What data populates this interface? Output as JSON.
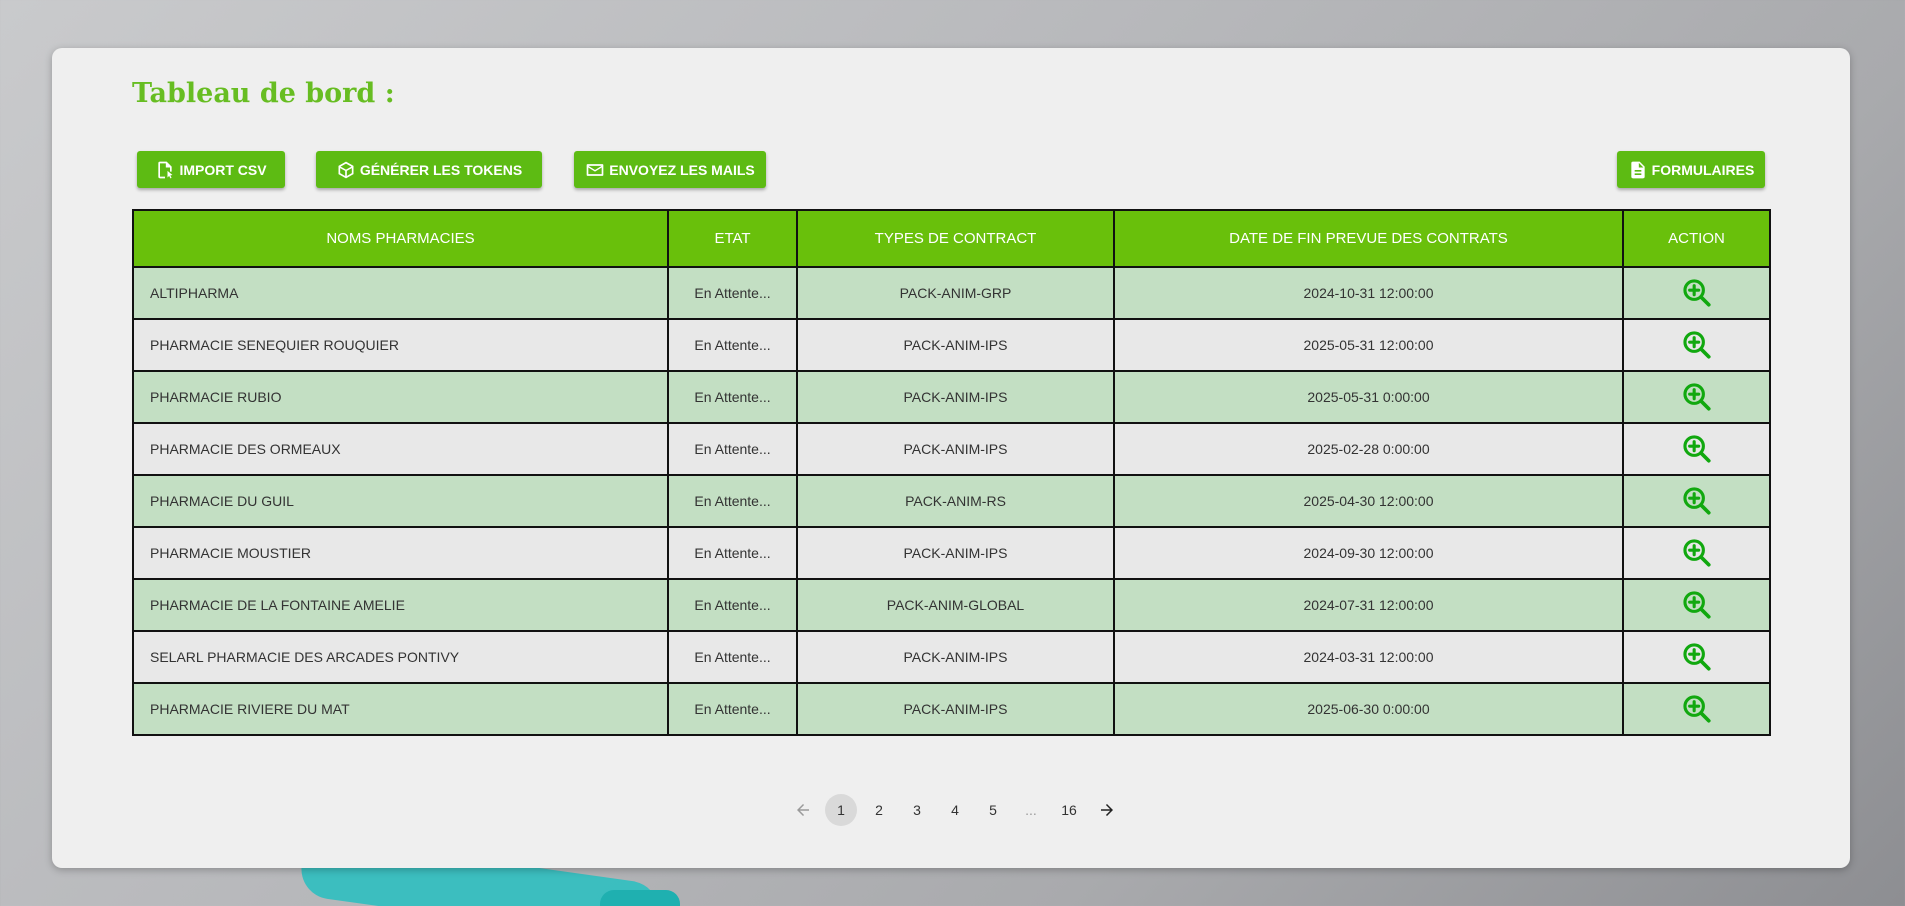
{
  "page": {
    "title": "Tableau de bord :"
  },
  "toolbar": {
    "import_label": "IMPORT CSV",
    "tokens_label": "GÉNÉRER LES TOKENS",
    "mails_label": "ENVOYEZ LES MAILS",
    "forms_label": "FORMULAIRES"
  },
  "table": {
    "headers": [
      "NOMS PHARMACIES",
      "ETAT",
      "TYPES DE CONTRACT",
      "DATE DE FIN PREVUE DES CONTRATS",
      "ACTION"
    ],
    "rows": [
      {
        "name": "ALTIPHARMA",
        "etat": "En Attente...",
        "type": "PACK-ANIM-GRP",
        "date": "2024-10-31 12:00:00"
      },
      {
        "name": "PHARMACIE SENEQUIER ROUQUIER",
        "etat": "En Attente...",
        "type": "PACK-ANIM-IPS",
        "date": "2025-05-31 12:00:00"
      },
      {
        "name": "PHARMACIE RUBIO",
        "etat": "En Attente...",
        "type": "PACK-ANIM-IPS",
        "date": "2025-05-31 0:00:00"
      },
      {
        "name": "PHARMACIE DES ORMEAUX",
        "etat": "En Attente...",
        "type": "PACK-ANIM-IPS",
        "date": "2025-02-28 0:00:00"
      },
      {
        "name": "PHARMACIE DU GUIL",
        "etat": "En Attente...",
        "type": "PACK-ANIM-RS",
        "date": "2025-04-30 12:00:00"
      },
      {
        "name": "PHARMACIE MOUSTIER",
        "etat": "En Attente...",
        "type": "PACK-ANIM-IPS",
        "date": "2024-09-30 12:00:00"
      },
      {
        "name": "PHARMACIE DE LA FONTAINE AMELIE",
        "etat": "En Attente...",
        "type": "PACK-ANIM-GLOBAL",
        "date": "2024-07-31 12:00:00"
      },
      {
        "name": "SELARL PHARMACIE DES ARCADES PONTIVY",
        "etat": "En Attente...",
        "type": "PACK-ANIM-IPS",
        "date": "2024-03-31 12:00:00"
      },
      {
        "name": "PHARMACIE RIVIERE DU MAT",
        "etat": "En Attente...",
        "type": "PACK-ANIM-IPS",
        "date": "2025-06-30 0:00:00"
      }
    ]
  },
  "pagination": {
    "pages": [
      "1",
      "2",
      "3",
      "4",
      "5",
      "...",
      "16"
    ],
    "current": "1"
  },
  "colors": {
    "accent": "#67bd22",
    "header_bg": "#69c00b",
    "row_green": "#c3dfc3",
    "row_grey": "#e8e8e8",
    "icon_green": "#11a80f"
  },
  "icons": {
    "import": "file-import-icon",
    "tokens": "cube-icon",
    "mails": "mail-icon",
    "forms": "document-icon",
    "action": "zoom-in-icon",
    "prev": "arrow-left-icon",
    "next": "arrow-right-icon"
  }
}
